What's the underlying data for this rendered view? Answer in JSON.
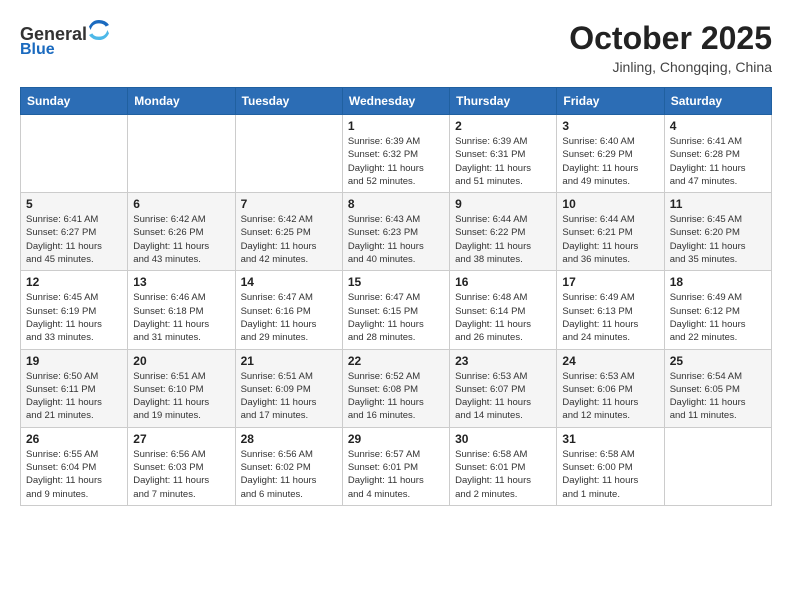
{
  "header": {
    "logo_line1": "General",
    "logo_line2": "Blue",
    "month": "October 2025",
    "location": "Jinling, Chongqing, China"
  },
  "days_of_week": [
    "Sunday",
    "Monday",
    "Tuesday",
    "Wednesday",
    "Thursday",
    "Friday",
    "Saturday"
  ],
  "weeks": [
    [
      {
        "day": "",
        "info": ""
      },
      {
        "day": "",
        "info": ""
      },
      {
        "day": "",
        "info": ""
      },
      {
        "day": "1",
        "info": "Sunrise: 6:39 AM\nSunset: 6:32 PM\nDaylight: 11 hours\nand 52 minutes."
      },
      {
        "day": "2",
        "info": "Sunrise: 6:39 AM\nSunset: 6:31 PM\nDaylight: 11 hours\nand 51 minutes."
      },
      {
        "day": "3",
        "info": "Sunrise: 6:40 AM\nSunset: 6:29 PM\nDaylight: 11 hours\nand 49 minutes."
      },
      {
        "day": "4",
        "info": "Sunrise: 6:41 AM\nSunset: 6:28 PM\nDaylight: 11 hours\nand 47 minutes."
      }
    ],
    [
      {
        "day": "5",
        "info": "Sunrise: 6:41 AM\nSunset: 6:27 PM\nDaylight: 11 hours\nand 45 minutes."
      },
      {
        "day": "6",
        "info": "Sunrise: 6:42 AM\nSunset: 6:26 PM\nDaylight: 11 hours\nand 43 minutes."
      },
      {
        "day": "7",
        "info": "Sunrise: 6:42 AM\nSunset: 6:25 PM\nDaylight: 11 hours\nand 42 minutes."
      },
      {
        "day": "8",
        "info": "Sunrise: 6:43 AM\nSunset: 6:23 PM\nDaylight: 11 hours\nand 40 minutes."
      },
      {
        "day": "9",
        "info": "Sunrise: 6:44 AM\nSunset: 6:22 PM\nDaylight: 11 hours\nand 38 minutes."
      },
      {
        "day": "10",
        "info": "Sunrise: 6:44 AM\nSunset: 6:21 PM\nDaylight: 11 hours\nand 36 minutes."
      },
      {
        "day": "11",
        "info": "Sunrise: 6:45 AM\nSunset: 6:20 PM\nDaylight: 11 hours\nand 35 minutes."
      }
    ],
    [
      {
        "day": "12",
        "info": "Sunrise: 6:45 AM\nSunset: 6:19 PM\nDaylight: 11 hours\nand 33 minutes."
      },
      {
        "day": "13",
        "info": "Sunrise: 6:46 AM\nSunset: 6:18 PM\nDaylight: 11 hours\nand 31 minutes."
      },
      {
        "day": "14",
        "info": "Sunrise: 6:47 AM\nSunset: 6:16 PM\nDaylight: 11 hours\nand 29 minutes."
      },
      {
        "day": "15",
        "info": "Sunrise: 6:47 AM\nSunset: 6:15 PM\nDaylight: 11 hours\nand 28 minutes."
      },
      {
        "day": "16",
        "info": "Sunrise: 6:48 AM\nSunset: 6:14 PM\nDaylight: 11 hours\nand 26 minutes."
      },
      {
        "day": "17",
        "info": "Sunrise: 6:49 AM\nSunset: 6:13 PM\nDaylight: 11 hours\nand 24 minutes."
      },
      {
        "day": "18",
        "info": "Sunrise: 6:49 AM\nSunset: 6:12 PM\nDaylight: 11 hours\nand 22 minutes."
      }
    ],
    [
      {
        "day": "19",
        "info": "Sunrise: 6:50 AM\nSunset: 6:11 PM\nDaylight: 11 hours\nand 21 minutes."
      },
      {
        "day": "20",
        "info": "Sunrise: 6:51 AM\nSunset: 6:10 PM\nDaylight: 11 hours\nand 19 minutes."
      },
      {
        "day": "21",
        "info": "Sunrise: 6:51 AM\nSunset: 6:09 PM\nDaylight: 11 hours\nand 17 minutes."
      },
      {
        "day": "22",
        "info": "Sunrise: 6:52 AM\nSunset: 6:08 PM\nDaylight: 11 hours\nand 16 minutes."
      },
      {
        "day": "23",
        "info": "Sunrise: 6:53 AM\nSunset: 6:07 PM\nDaylight: 11 hours\nand 14 minutes."
      },
      {
        "day": "24",
        "info": "Sunrise: 6:53 AM\nSunset: 6:06 PM\nDaylight: 11 hours\nand 12 minutes."
      },
      {
        "day": "25",
        "info": "Sunrise: 6:54 AM\nSunset: 6:05 PM\nDaylight: 11 hours\nand 11 minutes."
      }
    ],
    [
      {
        "day": "26",
        "info": "Sunrise: 6:55 AM\nSunset: 6:04 PM\nDaylight: 11 hours\nand 9 minutes."
      },
      {
        "day": "27",
        "info": "Sunrise: 6:56 AM\nSunset: 6:03 PM\nDaylight: 11 hours\nand 7 minutes."
      },
      {
        "day": "28",
        "info": "Sunrise: 6:56 AM\nSunset: 6:02 PM\nDaylight: 11 hours\nand 6 minutes."
      },
      {
        "day": "29",
        "info": "Sunrise: 6:57 AM\nSunset: 6:01 PM\nDaylight: 11 hours\nand 4 minutes."
      },
      {
        "day": "30",
        "info": "Sunrise: 6:58 AM\nSunset: 6:01 PM\nDaylight: 11 hours\nand 2 minutes."
      },
      {
        "day": "31",
        "info": "Sunrise: 6:58 AM\nSunset: 6:00 PM\nDaylight: 11 hours\nand 1 minute."
      },
      {
        "day": "",
        "info": ""
      }
    ]
  ]
}
